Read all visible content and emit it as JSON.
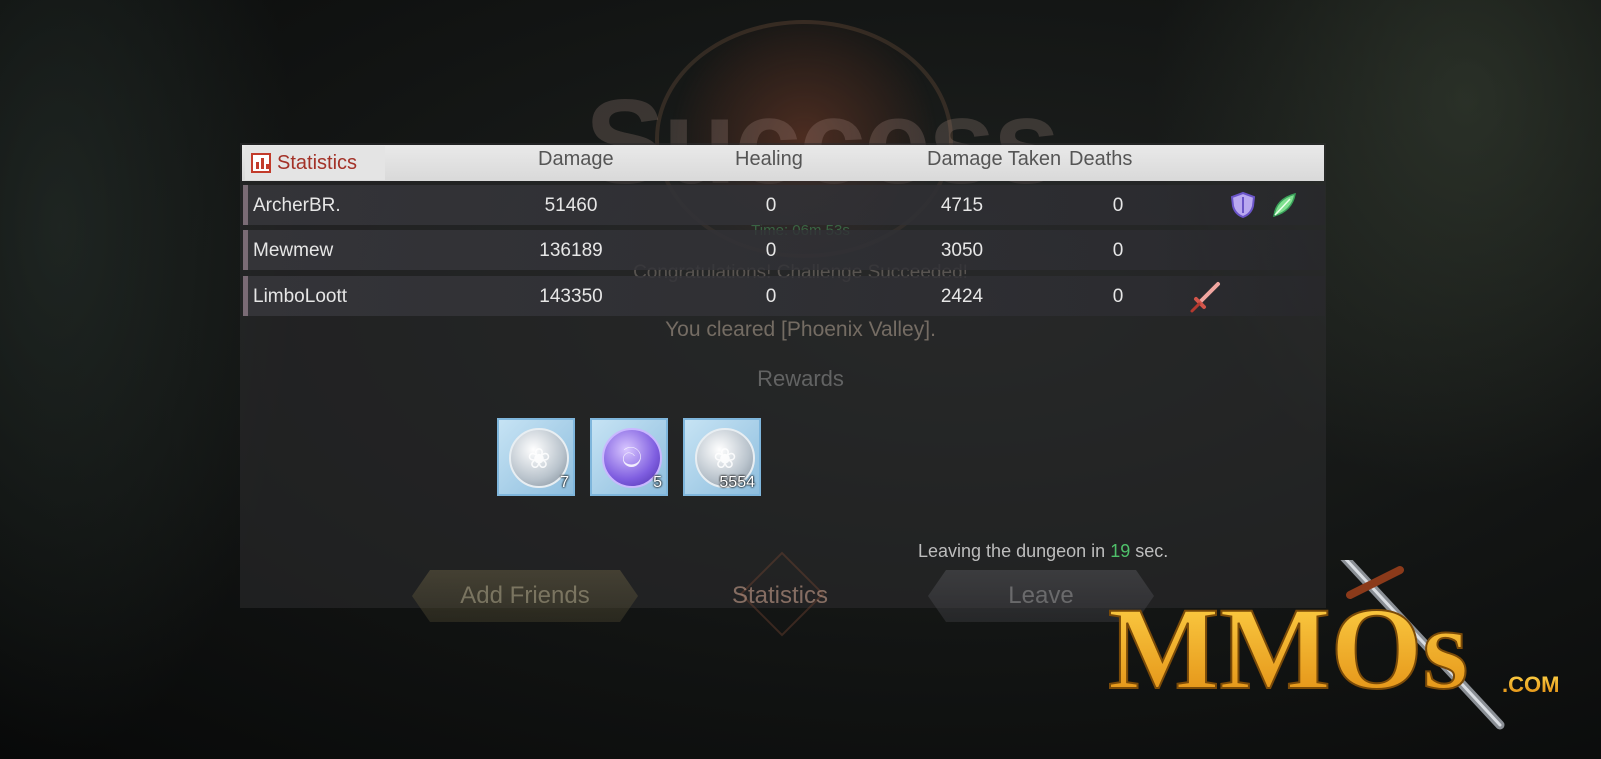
{
  "background": {
    "success_title": "Success",
    "time_line": "Time: 06m 53s",
    "congrats": "Congratulations! Challenge Succeeded!",
    "cleared": "You cleared [Phoenix Valley].",
    "rewards_heading": "Rewards"
  },
  "statistics": {
    "tab_label": "Statistics",
    "columns": {
      "damage": "Damage",
      "healing": "Healing",
      "damage_taken": "Damage Taken",
      "deaths": "Deaths"
    },
    "rows": [
      {
        "name": "ArcherBR.",
        "damage": "51460",
        "healing": "0",
        "damage_taken": "4715",
        "deaths": "0",
        "badges": [
          "shield-icon",
          "leaf-icon"
        ]
      },
      {
        "name": "Mewmew",
        "damage": "136189",
        "healing": "0",
        "damage_taken": "3050",
        "deaths": "0",
        "badges": []
      },
      {
        "name": "LimboLoott",
        "damage": "143350",
        "healing": "0",
        "damage_taken": "2424",
        "deaths": "0",
        "badges": [
          "sword-icon"
        ]
      }
    ]
  },
  "rewards": [
    {
      "icon": "dragon-coin-icon",
      "count": "7"
    },
    {
      "icon": "spirit-orb-icon",
      "count": "5"
    },
    {
      "icon": "dragon-coin-icon",
      "count": "5554"
    }
  ],
  "leaving": {
    "prefix": "Leaving the dungeon in",
    "seconds": "19",
    "suffix": "sec."
  },
  "buttons": {
    "add_friends": "Add Friends",
    "statistics": "Statistics",
    "leave": "Leave"
  },
  "watermark": {
    "text": "MMOs",
    "domain": ".COM"
  },
  "colors": {
    "accent_red": "#a33127",
    "timer_green": "#4fc06a",
    "logo_gold": "#f0b21c"
  }
}
